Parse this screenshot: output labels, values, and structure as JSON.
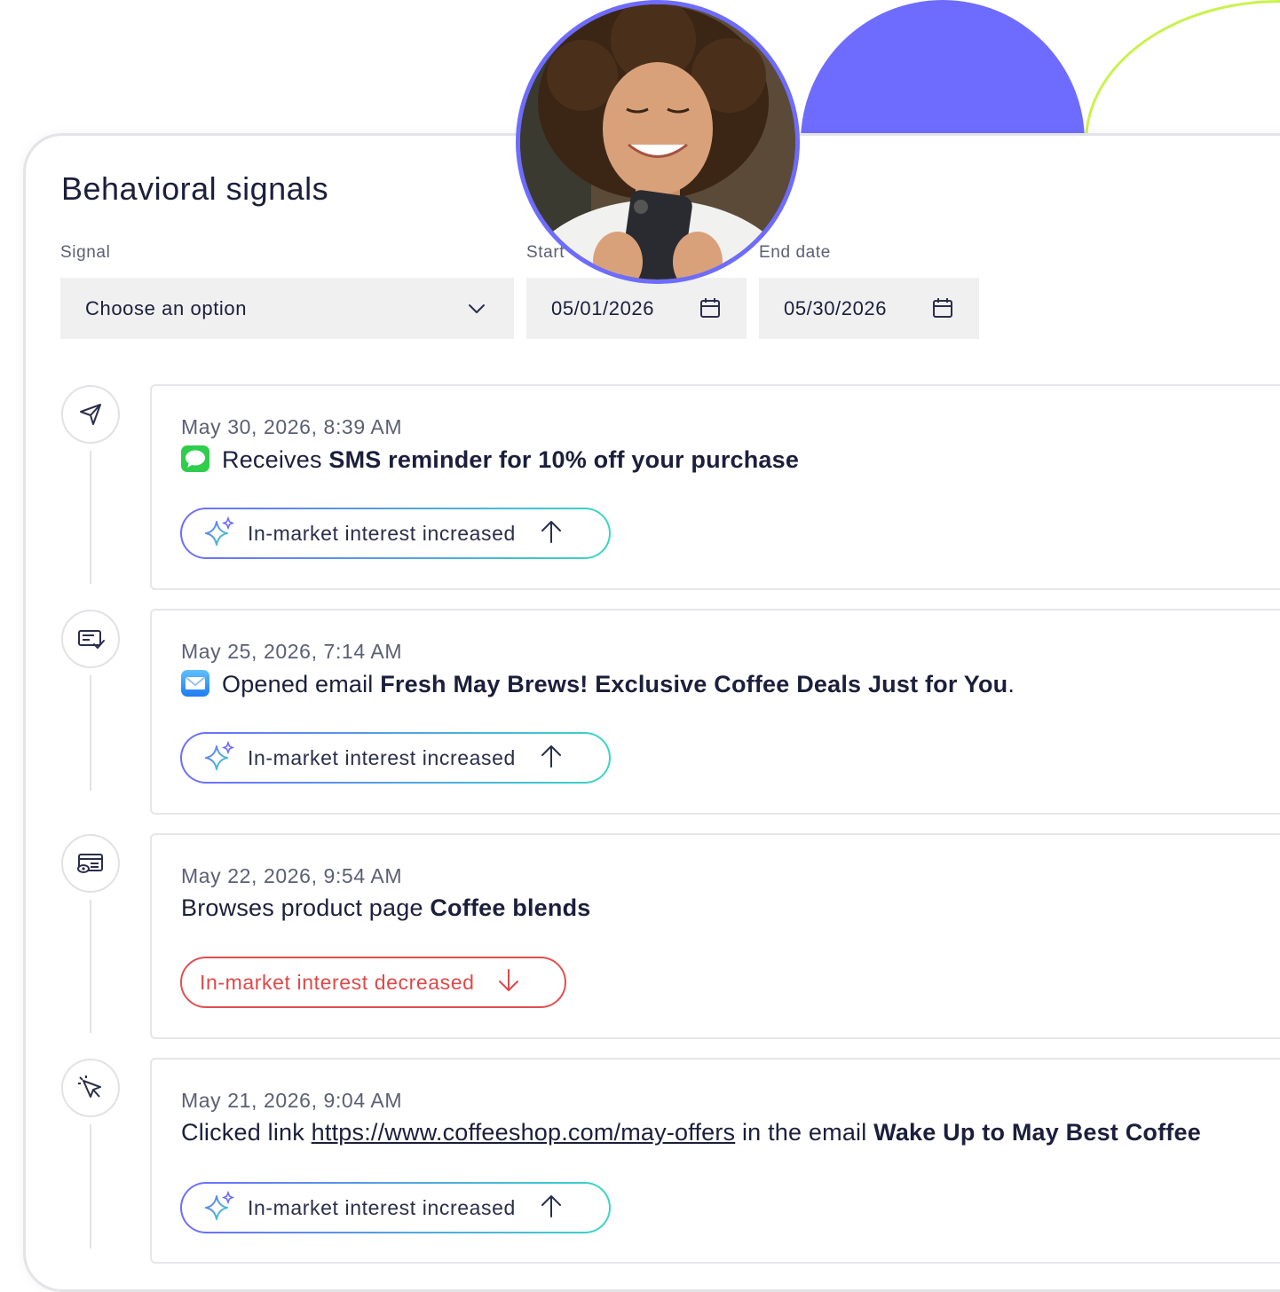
{
  "page": {
    "title": "Behavioral signals"
  },
  "filters": {
    "signal_label": "Signal",
    "signal_value": "Choose an option",
    "start_label": "Start",
    "start_value": "05/01/2026",
    "end_label": "End date",
    "end_value": "05/30/2026"
  },
  "events": [
    {
      "date": "May 30, 2026, 8:39 AM",
      "prefix": "Receives ",
      "bold": "SMS reminder for 10% off your purchase",
      "app_icon": "messages-app-icon",
      "timeline_icon": "send-icon",
      "badge": "In-market interest increased",
      "trend": "up"
    },
    {
      "date": "May 25, 2026, 7:14 AM",
      "prefix": "Opened email ",
      "bold": "Fresh May Brews! Exclusive Coffee Deals Just for You",
      "suffix": ".",
      "app_icon": "mail-app-icon",
      "timeline_icon": "email-check-icon",
      "badge": "In-market interest increased",
      "trend": "up"
    },
    {
      "date": "May 22, 2026, 9:54 AM",
      "prefix": "Browses product page ",
      "bold": "Coffee blends",
      "timeline_icon": "page-view-icon",
      "badge": "In-market interest decreased",
      "trend": "down"
    },
    {
      "date": "May 21, 2026, 9:04 AM",
      "prefix": "Clicked link ",
      "link": "https://www.coffeeshop.com/may-offers",
      "middle": " in the email ",
      "bold": "Wake Up to May Best Coffee",
      "timeline_icon": "cursor-click-icon",
      "badge": "In-market interest increased",
      "trend": "up"
    }
  ],
  "colors": {
    "accent": "#6e6cff",
    "accent_teal": "#38d6c6",
    "decrease": "#e04848",
    "lime": "#c8f34a"
  }
}
